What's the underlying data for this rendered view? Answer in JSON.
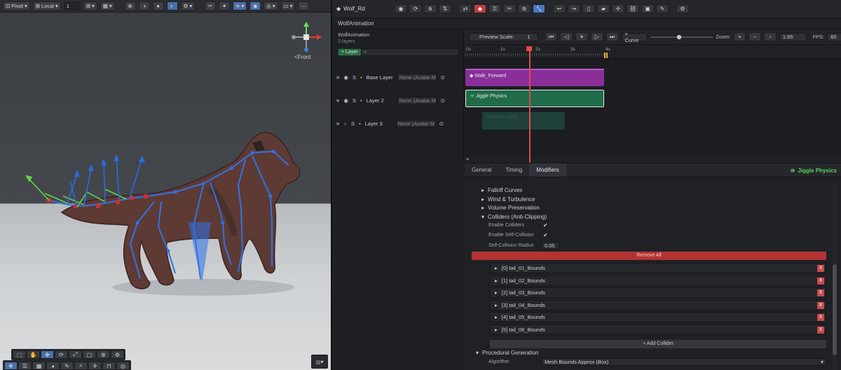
{
  "scene": {
    "toolbar": {
      "pivot_label": "Pivot",
      "local_label": "Local",
      "snap_value": "1"
    },
    "view_label": "<Front"
  },
  "header": {
    "tab_title": "Wolf_Rd",
    "window_title": "WolfAnimation"
  },
  "layers": {
    "header_title": "WolfAnimation",
    "header_count": "3 layers",
    "add_layer_label": "+ Layer",
    "items": [
      {
        "solo": "S",
        "name": "Base Layer",
        "mask": "None (Avatar Mask)"
      },
      {
        "solo": "S",
        "name": "Layer 2",
        "mask": "None (Avatar Mask)"
      },
      {
        "solo": "S",
        "name": "Layer 3",
        "mask": "None (Avatar Mask)"
      }
    ]
  },
  "timeline": {
    "preview_scale_label": "Preview Scale:",
    "preview_scale_value": "1",
    "curve_label": "× Curve",
    "zoom_label": "Zoom:",
    "zoom_value": "1.85",
    "fps_label": "FPS:",
    "fps_value": "60",
    "ruler_ticks": [
      "0s",
      "1s",
      "2s",
      "3s",
      "4s"
    ],
    "clips": [
      {
        "label": "Walk_Forward",
        "color": "#8a2f9a"
      },
      {
        "label": "Jiggle Physics",
        "color": "#1f6b4a"
      },
      {
        "label": "Override (Idle)",
        "color": "#1f4038"
      }
    ]
  },
  "inspector": {
    "tabs": [
      "General",
      "Timing",
      "Modifiers"
    ],
    "active_tab": "Modifiers",
    "title": "Jiggle Physics",
    "sections": {
      "falloff": "Falloff Curves",
      "wind": "Wind & Turbulence",
      "volume": "Volume Preservation",
      "colliders": "Colliders (Anti-Clipping)",
      "procedural": "Procedural Generation"
    },
    "props": {
      "enable_colliders": "Enable Colliders",
      "enable_self_collision": "Enable Self-Collision",
      "self_collision_radius": "Self-Collision Radius",
      "radius_value": "0.05",
      "check": "✔"
    },
    "remove_all_label": "Remove All",
    "colliders": [
      "[0] tail_01_Bounds",
      "[1] tail_02_Bounds",
      "[2] tail_03_Bounds",
      "[3] tail_04_Bounds",
      "[4] tail_05_Bounds",
      "[5] tail_06_Bounds"
    ],
    "remove_label": "X",
    "add_collider_label": "+ Add Collider",
    "algorithm_label": "Algorithm",
    "algorithm_value": "Mesh Bounds Approx (Box)"
  }
}
